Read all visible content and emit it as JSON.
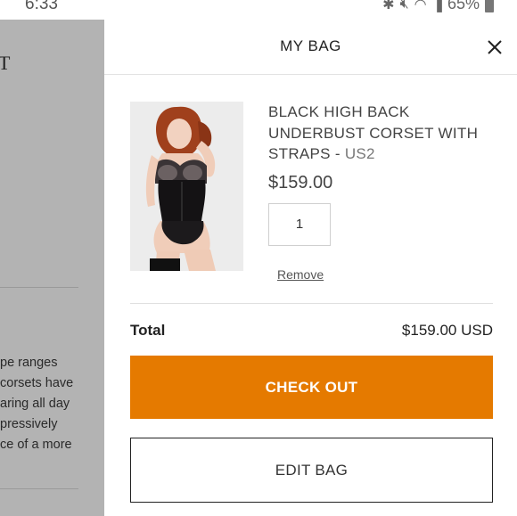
{
  "status_bar": {
    "time": "6:33",
    "battery_percent": "65%",
    "icons": [
      "bluetooth-icon",
      "mute-icon",
      "wifi-icon",
      "signal-icon",
      "battery-icon"
    ]
  },
  "background_page": {
    "title_fragment": "T",
    "text_lines": [
      "pe ranges",
      "corsets have",
      "aring all day",
      "pressively",
      "ce of a more"
    ]
  },
  "drawer": {
    "title": "MY BAG",
    "close_icon": "close-icon",
    "item": {
      "image_alt": "product-photo",
      "name": "BLACK HIGH BACK UNDERBUST CORSET WITH STRAPS",
      "separator": " - ",
      "variant": "US2",
      "price": "$159.00",
      "quantity": "1",
      "remove_label": "Remove"
    },
    "total_label": "Total",
    "total_value": "$159.00 USD",
    "checkout_label": "CHECK OUT",
    "edit_label": "EDIT BAG"
  },
  "colors": {
    "accent": "#e57a00",
    "overlay": "#b3b3b3"
  }
}
